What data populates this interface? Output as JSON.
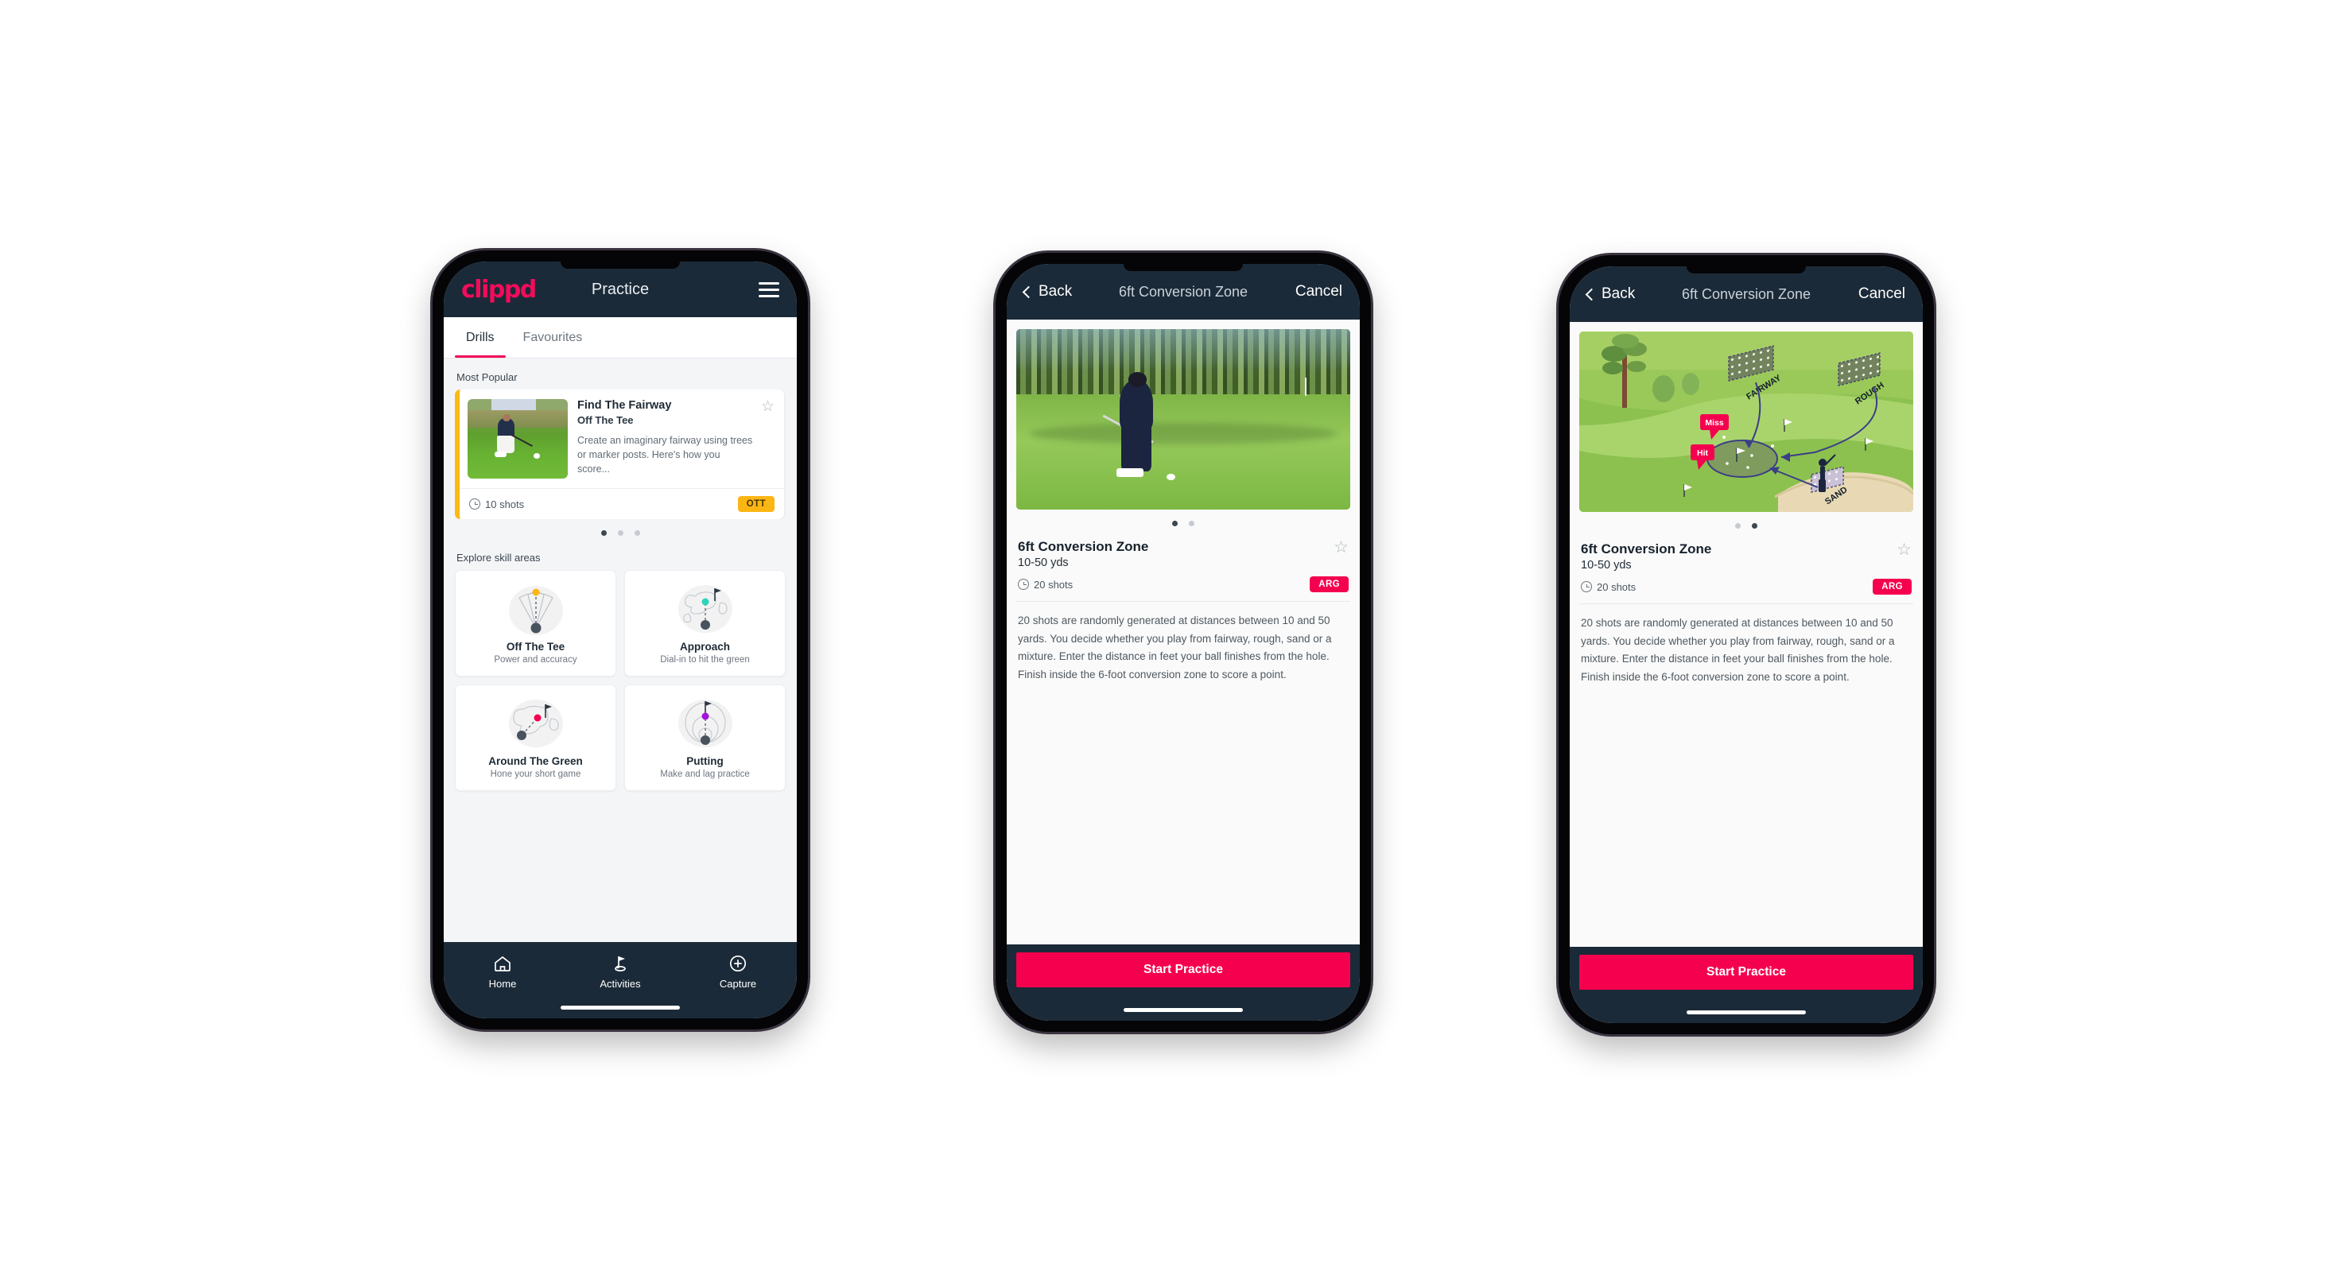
{
  "app": {
    "brand": "clippd",
    "accent": "#f20c5a",
    "header_bg": "#1b2a38"
  },
  "phone1": {
    "header": {
      "title": "Practice",
      "menu_icon": "hamburger-menu-icon"
    },
    "tabs": [
      {
        "label": "Drills",
        "active": true
      },
      {
        "label": "Favourites",
        "active": false
      }
    ],
    "most_popular_label": "Most Popular",
    "drill_card": {
      "title": "Find The Fairway",
      "subtitle": "Off The Tee",
      "description": "Create an imaginary fairway using trees or marker posts. Here's how you score...",
      "shots": "10 shots",
      "badge": "OTT",
      "badge_color": "#fcb614",
      "accent_bar": "#fdb913",
      "star_icon": "star-outline-icon",
      "clock_icon": "clock-icon",
      "next_card_accent": "#2ed4b8"
    },
    "carousel_dots": {
      "count": 3,
      "active_index": 0
    },
    "explore_label": "Explore skill areas",
    "skills": [
      {
        "name": "Off The Tee",
        "desc": "Power and accuracy",
        "icon": "tee-fan-icon",
        "dot_color": "#fcb614"
      },
      {
        "name": "Approach",
        "desc": "Dial-in to hit the green",
        "icon": "green-approach-icon",
        "dot_color": "#2ed4b8"
      },
      {
        "name": "Around The Green",
        "desc": "Hone your short game",
        "icon": "around-green-icon",
        "dot_color": "#f5004f"
      },
      {
        "name": "Putting",
        "desc": "Make and lag practice",
        "icon": "putting-rings-icon",
        "dot_color": "#a613d8"
      }
    ],
    "bottom_nav": [
      {
        "label": "Home",
        "icon": "home-icon",
        "active": false
      },
      {
        "label": "Activities",
        "icon": "golf-flag-icon",
        "active": true
      },
      {
        "label": "Capture",
        "icon": "plus-circle-icon",
        "active": false
      }
    ]
  },
  "phone2": {
    "nav": {
      "back": "Back",
      "title": "6ft Conversion Zone",
      "cancel": "Cancel",
      "back_icon": "chevron-left-icon"
    },
    "media": {
      "type": "video-thumbnail",
      "alt": "golfer-chipping-photo"
    },
    "dots": {
      "count": 2,
      "active_index": 0
    },
    "title": "6ft Conversion Zone",
    "distance": "10-50 yds",
    "shots": "20 shots",
    "badge": "ARG",
    "badge_color": "#f5004f",
    "star_icon": "star-outline-icon",
    "clock_icon": "clock-icon",
    "description": "20 shots are randomly generated at distances between 10 and 50 yards. You decide whether you play from fairway, rough, sand or a mixture. Enter the distance in feet your ball finishes from the hole. Finish inside the 6-foot conversion zone to score a point.",
    "cta": "Start Practice"
  },
  "phone3": {
    "nav": {
      "back": "Back",
      "title": "6ft Conversion Zone",
      "cancel": "Cancel",
      "back_icon": "chevron-left-icon"
    },
    "media": {
      "type": "course-illustration",
      "labels": [
        "FAIRWAY",
        "ROUGH",
        "SAND"
      ],
      "callouts": [
        "Miss",
        "Hit"
      ],
      "callout_color": "#f5004f"
    },
    "dots": {
      "count": 2,
      "active_index": 1
    },
    "title": "6ft Conversion Zone",
    "distance": "10-50 yds",
    "shots": "20 shots",
    "badge": "ARG",
    "badge_color": "#f5004f",
    "star_icon": "star-outline-icon",
    "clock_icon": "clock-icon",
    "description": "20 shots are randomly generated at distances between 10 and 50 yards. You decide whether you play from fairway, rough, sand or a mixture. Enter the distance in feet your ball finishes from the hole. Finish inside the 6-foot conversion zone to score a point.",
    "cta": "Start Practice"
  }
}
